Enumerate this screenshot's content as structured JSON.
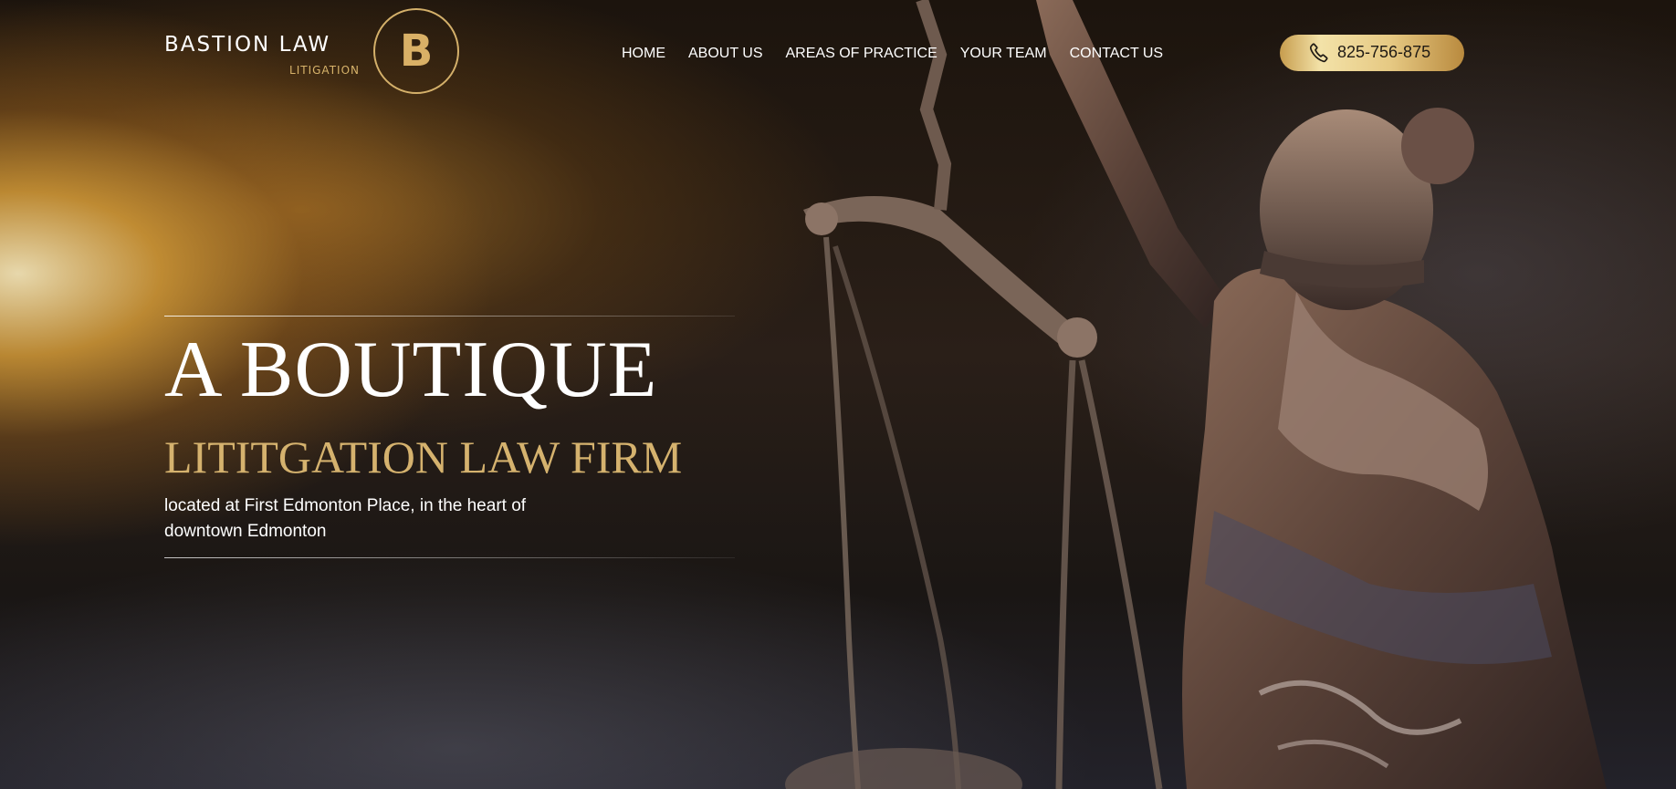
{
  "header": {
    "logo": {
      "name": "BASTION LAW",
      "tagline": "LITIGATION",
      "monogram": "B"
    },
    "nav": [
      {
        "label": "HOME"
      },
      {
        "label": "ABOUT US"
      },
      {
        "label": "AREAS OF PRACTICE"
      },
      {
        "label": "YOUR TEAM"
      },
      {
        "label": "CONTACT US"
      }
    ],
    "phone": {
      "icon": "phone-icon",
      "number": "825-756-875"
    }
  },
  "hero": {
    "headline": "A BOUTIQUE",
    "subheadline": "LITITGATION LAW FIRM",
    "description": "located at First Edmonton Place, in the heart of downtown Edmonton"
  },
  "colors": {
    "accent_gold": "#d5b26e",
    "text_light": "#ffffff",
    "background_dark": "#120d0a"
  }
}
